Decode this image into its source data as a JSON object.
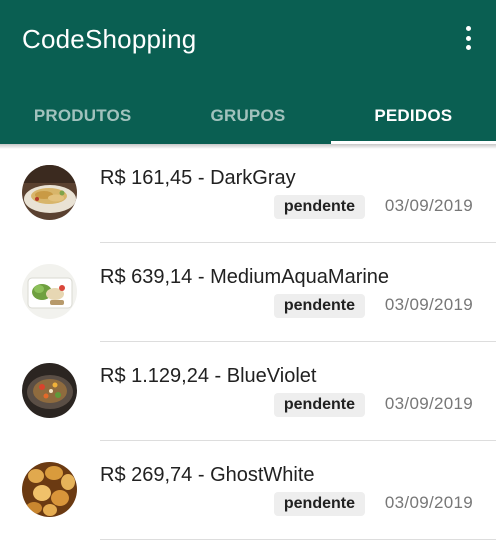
{
  "app": {
    "title": "CodeShopping"
  },
  "colors": {
    "primary": "#0a5f52",
    "badge_bg": "#eeeeee",
    "date_text": "#777777"
  },
  "tabs": [
    {
      "label": "PRODUTOS",
      "active": false
    },
    {
      "label": "GRUPOS",
      "active": false
    },
    {
      "label": "PEDIDOS",
      "active": true
    }
  ],
  "orders": [
    {
      "title": "R$ 161,45 - DarkGray",
      "status": "pendente",
      "date": "03/09/2019",
      "image_icon": "food-dish-photo"
    },
    {
      "title": "R$ 639,14 - MediumAquaMarine",
      "status": "pendente",
      "date": "03/09/2019",
      "image_icon": "salad-photo"
    },
    {
      "title": "R$ 1.129,24 - BlueViolet",
      "status": "pendente",
      "date": "03/09/2019",
      "image_icon": "stir-fry-photo"
    },
    {
      "title": "R$ 269,74 - GhostWhite",
      "status": "pendente",
      "date": "03/09/2019",
      "image_icon": "potatoes-photo"
    }
  ]
}
